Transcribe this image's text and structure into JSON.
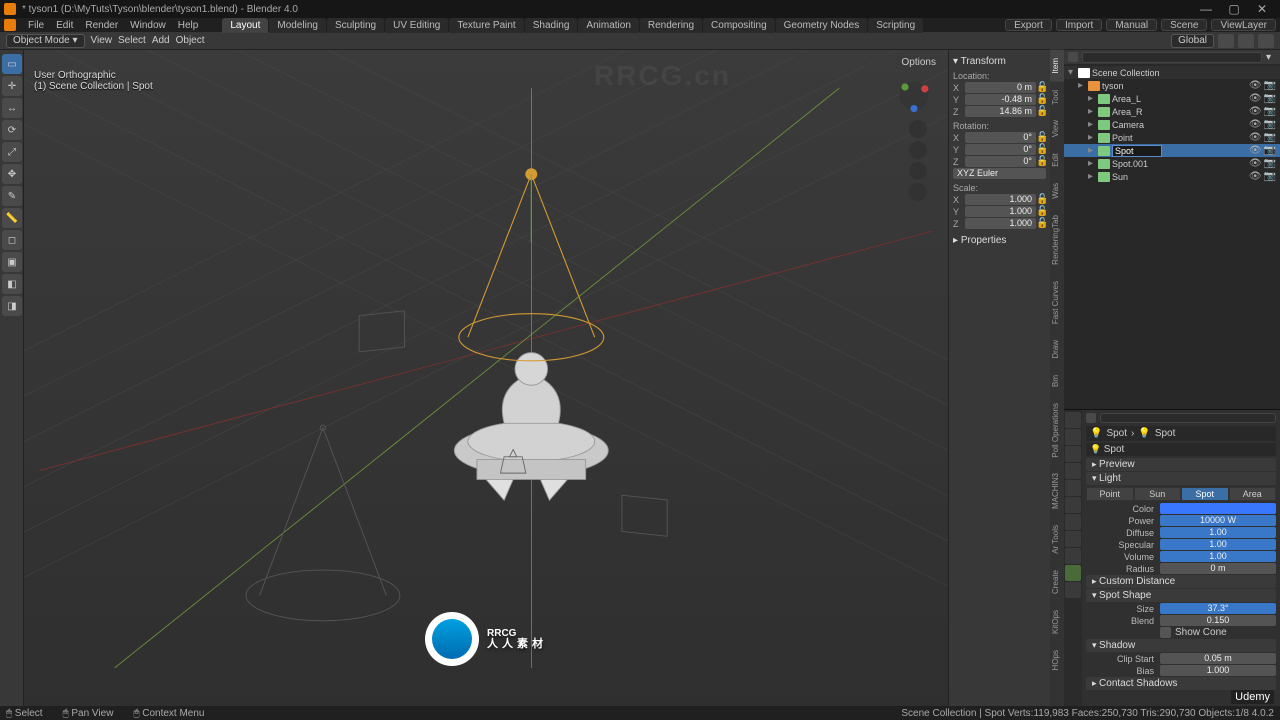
{
  "window": {
    "title": "* tyson1 (D:\\MyTuts\\Tyson\\blender\\tyson1.blend) - Blender 4.0"
  },
  "menu": {
    "items": [
      "File",
      "Edit",
      "Render",
      "Window",
      "Help"
    ],
    "workspaces": [
      "Layout",
      "Modeling",
      "Sculpting",
      "UV Editing",
      "Texture Paint",
      "Shading",
      "Animation",
      "Rendering",
      "Compositing",
      "Geometry Nodes",
      "Scripting"
    ],
    "active_workspace": "Layout",
    "scene": "Scene",
    "viewlayer": "ViewLayer",
    "export": "Export",
    "import": "Import",
    "manual": "Manual"
  },
  "modebar": {
    "mode": "Object Mode",
    "dropdowns": [
      "View",
      "Select",
      "Add",
      "Object"
    ],
    "orientation": "Global",
    "options": "Options"
  },
  "viewport": {
    "overlay_line1": "User Orthographic",
    "overlay_line2": "(1) Scene Collection | Spot"
  },
  "tools": [
    "select-box",
    "cursor",
    "move",
    "rotate",
    "scale",
    "transform",
    "annotate",
    "measure",
    "add-cube",
    "extrude",
    "shear",
    "bevel"
  ],
  "n_panel": {
    "title": "Transform",
    "location_label": "Location:",
    "location": {
      "X": "0 m",
      "Y": "-0.48 m",
      "Z": "14.86 m"
    },
    "rotation_label": "Rotation:",
    "rotation": {
      "X": "0°",
      "Y": "0°",
      "Z": "0°"
    },
    "rotation_mode": "XYZ Euler",
    "scale_label": "Scale:",
    "scale": {
      "X": "1.000",
      "Y": "1.000",
      "Z": "1.000"
    },
    "properties_label": "Properties",
    "tabs": [
      "Item",
      "Tool",
      "View",
      "Edit",
      "Was",
      "RenderingTab",
      "Fast Curves",
      "Draw",
      "Bm",
      "Poll Operations",
      "MACHIN3",
      "Ar Tools",
      "Create",
      "KitOps",
      "HOps"
    ]
  },
  "outliner": {
    "root": "Scene Collection",
    "items": [
      {
        "name": "tyson",
        "type": "mesh"
      },
      {
        "name": "Area_L",
        "type": "light"
      },
      {
        "name": "Area_R",
        "type": "light"
      },
      {
        "name": "Camera",
        "type": "camera"
      },
      {
        "name": "Point",
        "type": "light"
      },
      {
        "name": "Spot",
        "type": "light",
        "selected": true,
        "editing": true
      },
      {
        "name": "Spot.001",
        "type": "light"
      },
      {
        "name": "Sun",
        "type": "light"
      }
    ]
  },
  "props": {
    "crumb": [
      "Spot",
      "Spot"
    ],
    "name": "Spot",
    "sections": {
      "preview": "Preview",
      "light": "Light",
      "custom_distance": "Custom Distance",
      "spot_shape": "Spot Shape",
      "shadow": "Shadow",
      "contact_shadows": "Contact Shadows"
    },
    "light_types": [
      "Point",
      "Sun",
      "Spot",
      "Area"
    ],
    "active_type": "Spot",
    "fields": {
      "color_label": "Color",
      "power_label": "Power",
      "power": "10000 W",
      "diffuse_label": "Diffuse",
      "diffuse": "1.00",
      "specular_label": "Specular",
      "specular": "1.00",
      "volume_label": "Volume",
      "volume": "1.00",
      "radius_label": "Radius",
      "radius": "0 m",
      "size_label": "Size",
      "size": "37.3°",
      "blend_label": "Blend",
      "blend": "0.150",
      "show_cone_label": "Show Cone",
      "clip_start_label": "Clip Start",
      "clip_start": "0.05 m",
      "bias_label": "Bias",
      "bias": "1.000"
    }
  },
  "status": {
    "select": "Select",
    "pan": "Pan View",
    "context": "Context Menu",
    "right": "Scene Collection | Spot    Verts:119,983  Faces:250,730  Tris:290,730    Objects:1/8    4.0.2"
  },
  "branding": {
    "watermark": "RRCG.cn",
    "logo_text": "RRCG",
    "logo_sub": "人人素材",
    "udemy": "Udemy"
  }
}
